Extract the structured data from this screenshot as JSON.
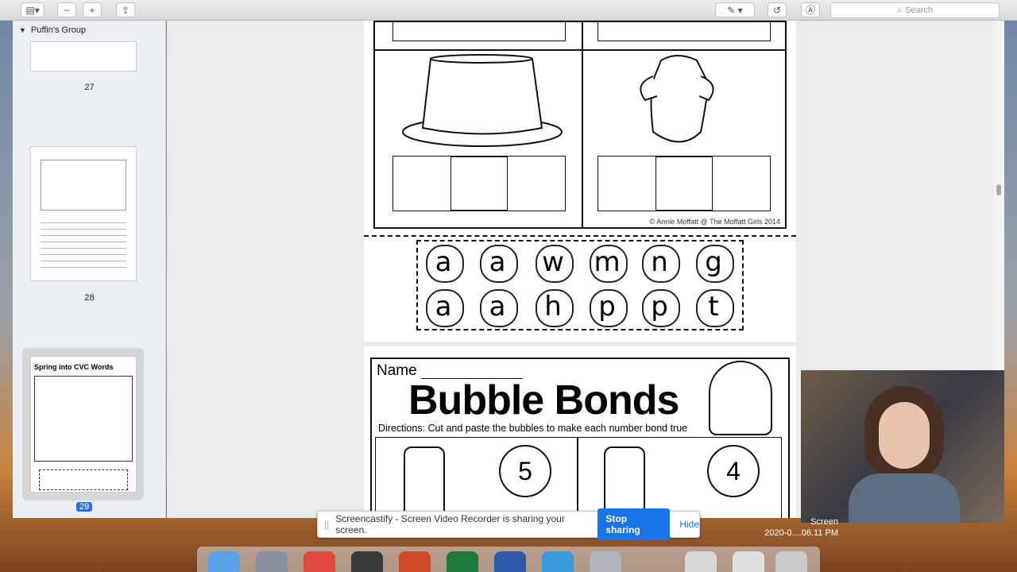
{
  "sidebar": {
    "group": "Puffin's Group",
    "pages": [
      "27",
      "28",
      "29"
    ],
    "thumb29_title": "Spring into CVC Words"
  },
  "toolbar": {
    "search_placeholder": "Search"
  },
  "worksheet": {
    "credit": "© Annie Moffatt @ The Moffatt Girls 2014",
    "letters_row1": [
      "a",
      "a",
      "w",
      "m",
      "n",
      "g"
    ],
    "letters_row2": [
      "a",
      "a",
      "h",
      "p",
      "p",
      "t"
    ]
  },
  "bubble": {
    "name_label": "Name",
    "title": "Bubble Bonds",
    "directions": "Directions: Cut and paste the bubbles to make each number bond true",
    "bond1": "5",
    "bond2": "4"
  },
  "banner": {
    "text": "Screencastify - Screen Video Recorder is sharing your screen.",
    "stop": "Stop sharing",
    "hide": "Hide"
  },
  "desktop": {
    "file_label": "Screen",
    "file_time": "2020-0....06.11 PM"
  }
}
